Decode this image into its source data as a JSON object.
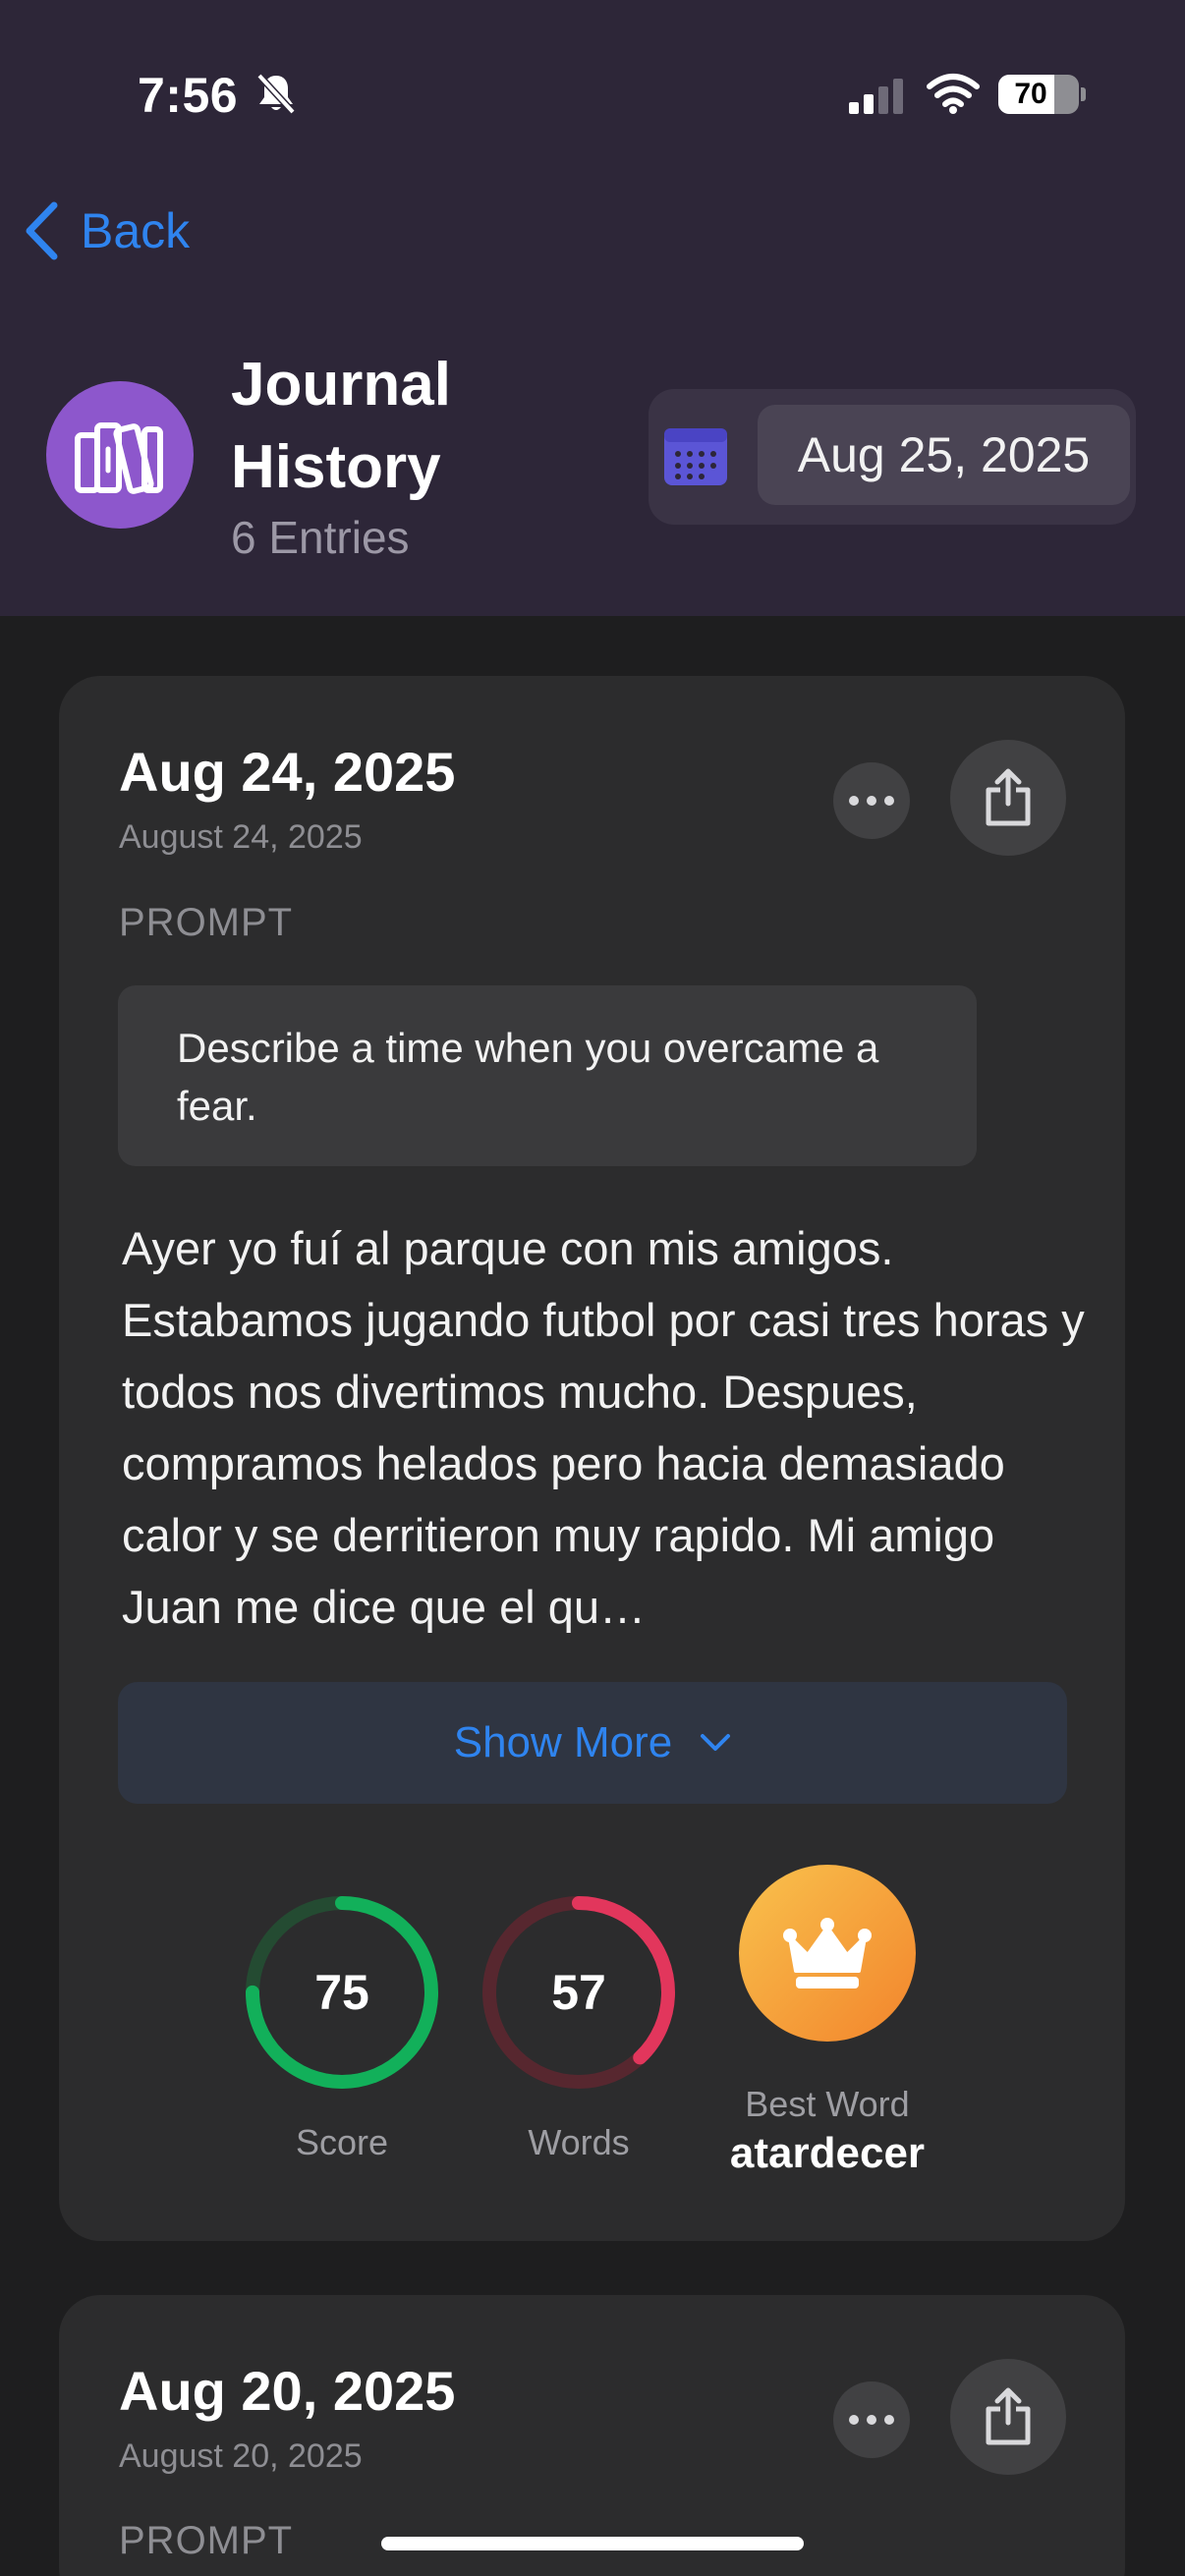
{
  "status_bar": {
    "time": "7:56",
    "battery": "70",
    "battery_level": 0.7
  },
  "nav": {
    "back_label": "Back",
    "title": "Journal History",
    "entry_count": "6 Entries",
    "selected_date": "Aug 25, 2025"
  },
  "entries": [
    {
      "date": "Aug 24, 2025",
      "full_date": "August 24, 2025",
      "prompt_label": "PROMPT",
      "prompt": "Describe a time when you overcame a fear.",
      "text": "Ayer yo fuí al parque con mis amigos. Estabamos jugando futbol por casi tres horas y todos nos divertimos mucho. Despues, compramos helados pero hacia demasiado calor y se derritieron muy rapido. Mi amigo Juan me dice que el qu…",
      "show_more_label": "Show More",
      "score": "75",
      "score_fraction": 0.75,
      "score_label": "Score",
      "words": "57",
      "words_fraction": 0.38,
      "words_label": "Words",
      "best_word_label": "Best Word",
      "best_word": "atardecer"
    },
    {
      "date": "Aug 20, 2025",
      "full_date": "August 20, 2025",
      "prompt_label": "PROMPT"
    }
  ],
  "colors": {
    "accent": "#2f84ef",
    "score_ring": "#12b05a",
    "words_ring": "#e2365c",
    "avatar": "#8d57cc",
    "best_word_badge": "#f5a23a"
  }
}
